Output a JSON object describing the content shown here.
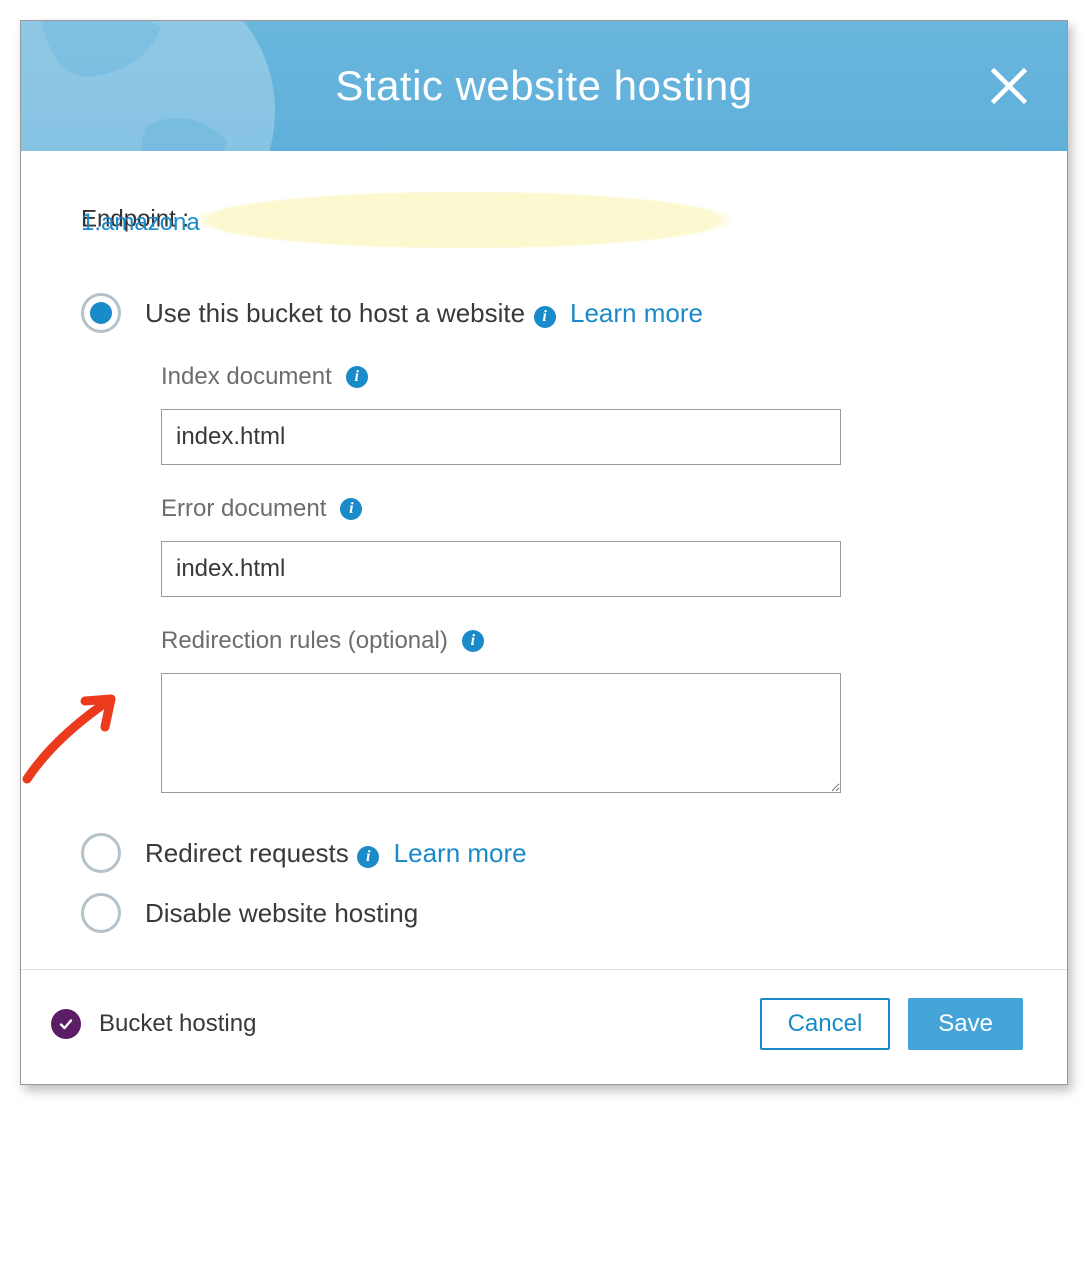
{
  "header": {
    "title": "Static website hosting"
  },
  "endpoint": {
    "label": "Endpoint : ",
    "link_text": "1.amazona"
  },
  "options": {
    "host": {
      "selected": true,
      "label": "Use this bucket to host a website",
      "learn_more": "Learn more"
    },
    "redirect": {
      "selected": false,
      "label": "Redirect requests",
      "learn_more": "Learn more"
    },
    "disable": {
      "selected": false,
      "label": "Disable website hosting"
    }
  },
  "fields": {
    "index_doc": {
      "label": "Index document",
      "value": "index.html"
    },
    "error_doc": {
      "label": "Error document",
      "value": "index.html"
    },
    "redirect_rules": {
      "label": "Redirection rules (optional)",
      "value": ""
    }
  },
  "footer": {
    "status": "Bucket hosting",
    "cancel": "Cancel",
    "save": "Save"
  }
}
